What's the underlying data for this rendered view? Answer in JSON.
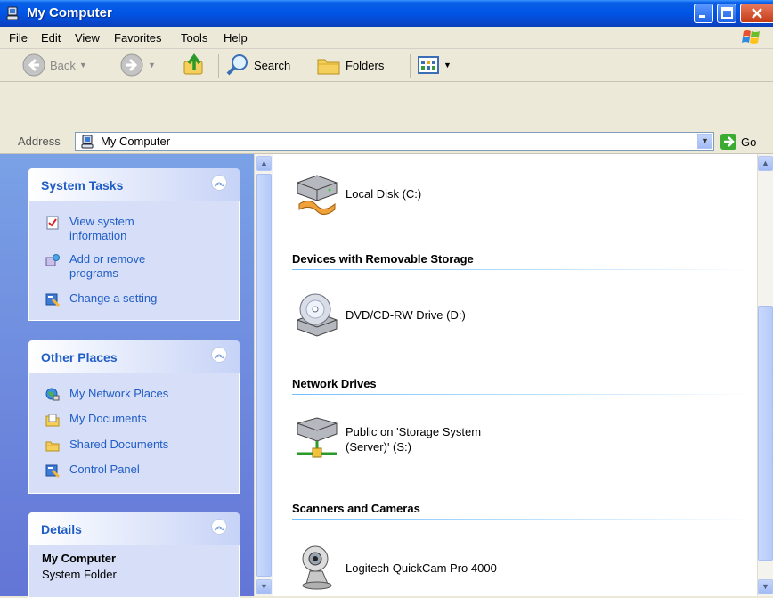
{
  "window": {
    "title": "My Computer"
  },
  "menu": [
    "File",
    "Edit",
    "View",
    "Favorites",
    "Tools",
    "Help"
  ],
  "toolbar": {
    "back": "Back",
    "search": "Search",
    "folders": "Folders"
  },
  "address": {
    "label": "Address",
    "value": "My Computer",
    "go": "Go"
  },
  "system_tasks": {
    "title": "System Tasks",
    "items": [
      {
        "label": "View system information",
        "icon": "system-info-icon"
      },
      {
        "label": "Add or remove programs",
        "icon": "add-remove-icon"
      },
      {
        "label": "Change a setting",
        "icon": "control-panel-icon"
      }
    ]
  },
  "other_places": {
    "title": "Other Places",
    "items": [
      {
        "label": "My Network Places",
        "icon": "network-places-icon"
      },
      {
        "label": "My Documents",
        "icon": "my-documents-icon"
      },
      {
        "label": "Shared Documents",
        "icon": "folder-icon"
      },
      {
        "label": "Control Panel",
        "icon": "control-panel-icon"
      }
    ]
  },
  "details": {
    "title": "Details",
    "name": "My Computer",
    "type": "System Folder"
  },
  "content": {
    "local_disk": "Local Disk (C:)",
    "groups": [
      {
        "title": "Devices with Removable Storage",
        "items": [
          "DVD/CD-RW Drive (D:)"
        ]
      },
      {
        "title": "Network Drives",
        "items": [
          "Public on 'Storage System (Server)' (S:)"
        ]
      },
      {
        "title": "Scanners and Cameras",
        "items": [
          "Logitech QuickCam Pro 4000"
        ]
      }
    ]
  },
  "colors": {
    "title_bar": "#0055e5",
    "task_link": "#215dc6",
    "task_pane": "#7aa1e6"
  }
}
